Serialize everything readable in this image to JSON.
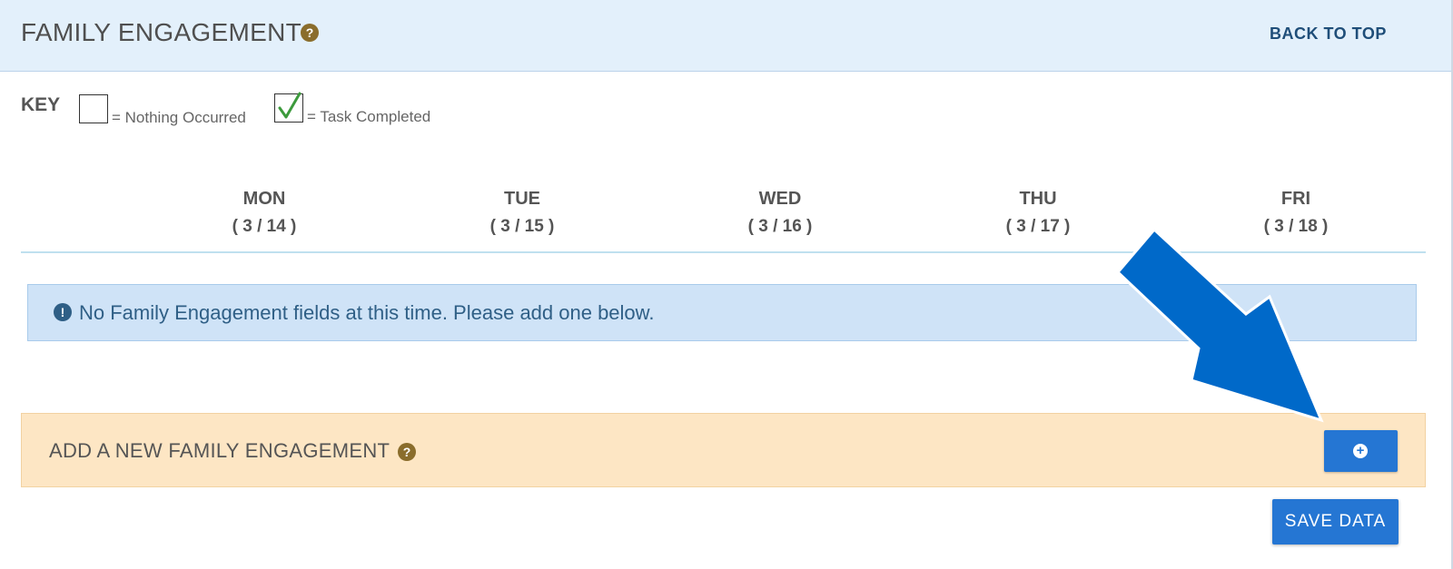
{
  "header": {
    "title": "FAMILY ENGAGEMENT",
    "help_icon": "question-circle-icon",
    "back_to_top": "BACK TO TOP"
  },
  "key": {
    "label": "KEY",
    "nothing_occurred": "= Nothing Occurred",
    "task_completed": "= Task Completed"
  },
  "days": [
    {
      "name": "MON",
      "date": "( 3 / 14 )"
    },
    {
      "name": "TUE",
      "date": "( 3 / 15 )"
    },
    {
      "name": "WED",
      "date": "( 3 / 16 )"
    },
    {
      "name": "THU",
      "date": "( 3 / 17 )"
    },
    {
      "name": "FRI",
      "date": "( 3 / 18 )"
    }
  ],
  "alert": {
    "icon": "exclamation-circle-icon",
    "text": "No Family Engagement fields at this time. Please add one below."
  },
  "add_panel": {
    "title": "ADD A NEW FAMILY ENGAGEMENT",
    "button_icon": "plus-circle-icon"
  },
  "save_button": "SAVE DATA",
  "colors": {
    "header_bg": "#e3f0fb",
    "alert_bg": "#cfe3f7",
    "add_panel_bg": "#fde6c4",
    "button_blue": "#2576d3",
    "annotation_arrow": "#0069c9",
    "check_green": "#3c9a3c"
  }
}
